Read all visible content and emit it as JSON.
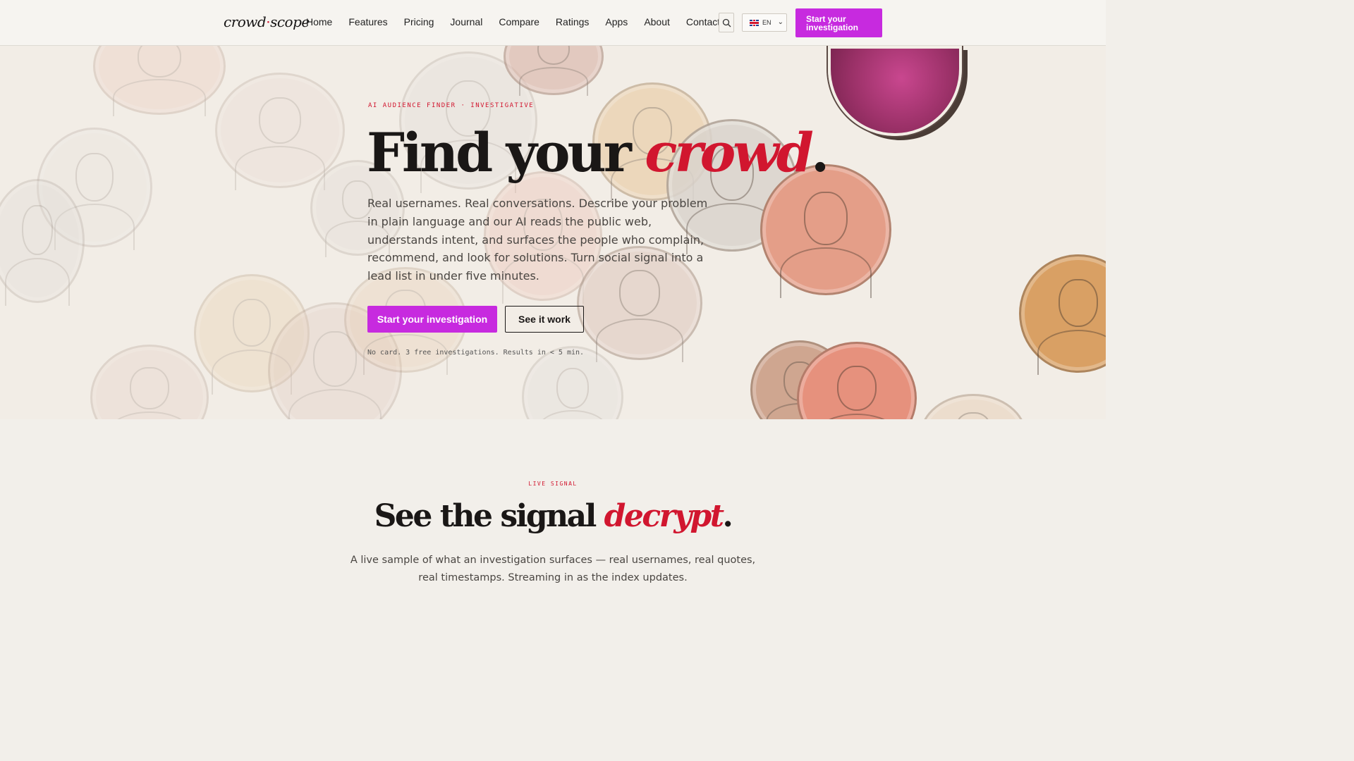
{
  "brand": {
    "logo_left": "crowd",
    "logo_dot": "·",
    "logo_right": "scope"
  },
  "nav": {
    "items": [
      "Home",
      "Features",
      "Pricing",
      "Journal",
      "Compare",
      "Ratings",
      "Apps",
      "About",
      "Contact"
    ],
    "search_icon": "search-icon",
    "language": "EN",
    "cta": "Start your investigation"
  },
  "hero": {
    "eyebrow": "AI AUDIENCE FINDER · INVESTIGATIVE",
    "title_main": "Find your ",
    "title_accent": "crowd",
    "title_end": ".",
    "body": "Real usernames. Real conversations. Describe your problem in plain language and our AI reads the public web, understands intent, and surfaces the people who complain, recommend, and look for solutions. Turn social signal into a lead list in under five minutes.",
    "primary_cta": "Start your investigation",
    "secondary_cta": "See it work",
    "fine_print": "No card. 3 free investigations. Results in < 5 min."
  },
  "live_signal": {
    "eyebrow": "LIVE SIGNAL",
    "title_main": "See the signal ",
    "title_accent": "decrypt",
    "title_end": ".",
    "body": "A live sample of what an investigation surfaces — real usernames, real quotes, real timestamps. Streaming in as the index updates."
  },
  "colors": {
    "accent_red": "#d1162f",
    "cta_purple": "#c72adf",
    "background": "#f2efea"
  }
}
